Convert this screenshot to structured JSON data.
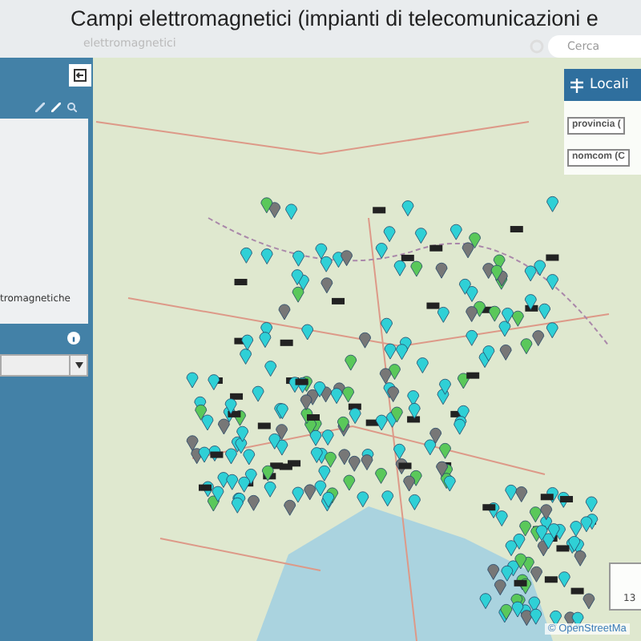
{
  "header": {
    "title": "Campi elettromagnetici (impianti di telecomunicazioni e",
    "subtitle": "elettromagnetici",
    "search": {
      "placeholder": "Cerca"
    }
  },
  "side_panel": {
    "layer_text": "tromagnetiche"
  },
  "locate_panel": {
    "title": "Locali",
    "fields": [
      "provincia (",
      "nomcom (C"
    ]
  },
  "map": {
    "scale_text": "13",
    "attribution": "© OpenStreetMa"
  }
}
